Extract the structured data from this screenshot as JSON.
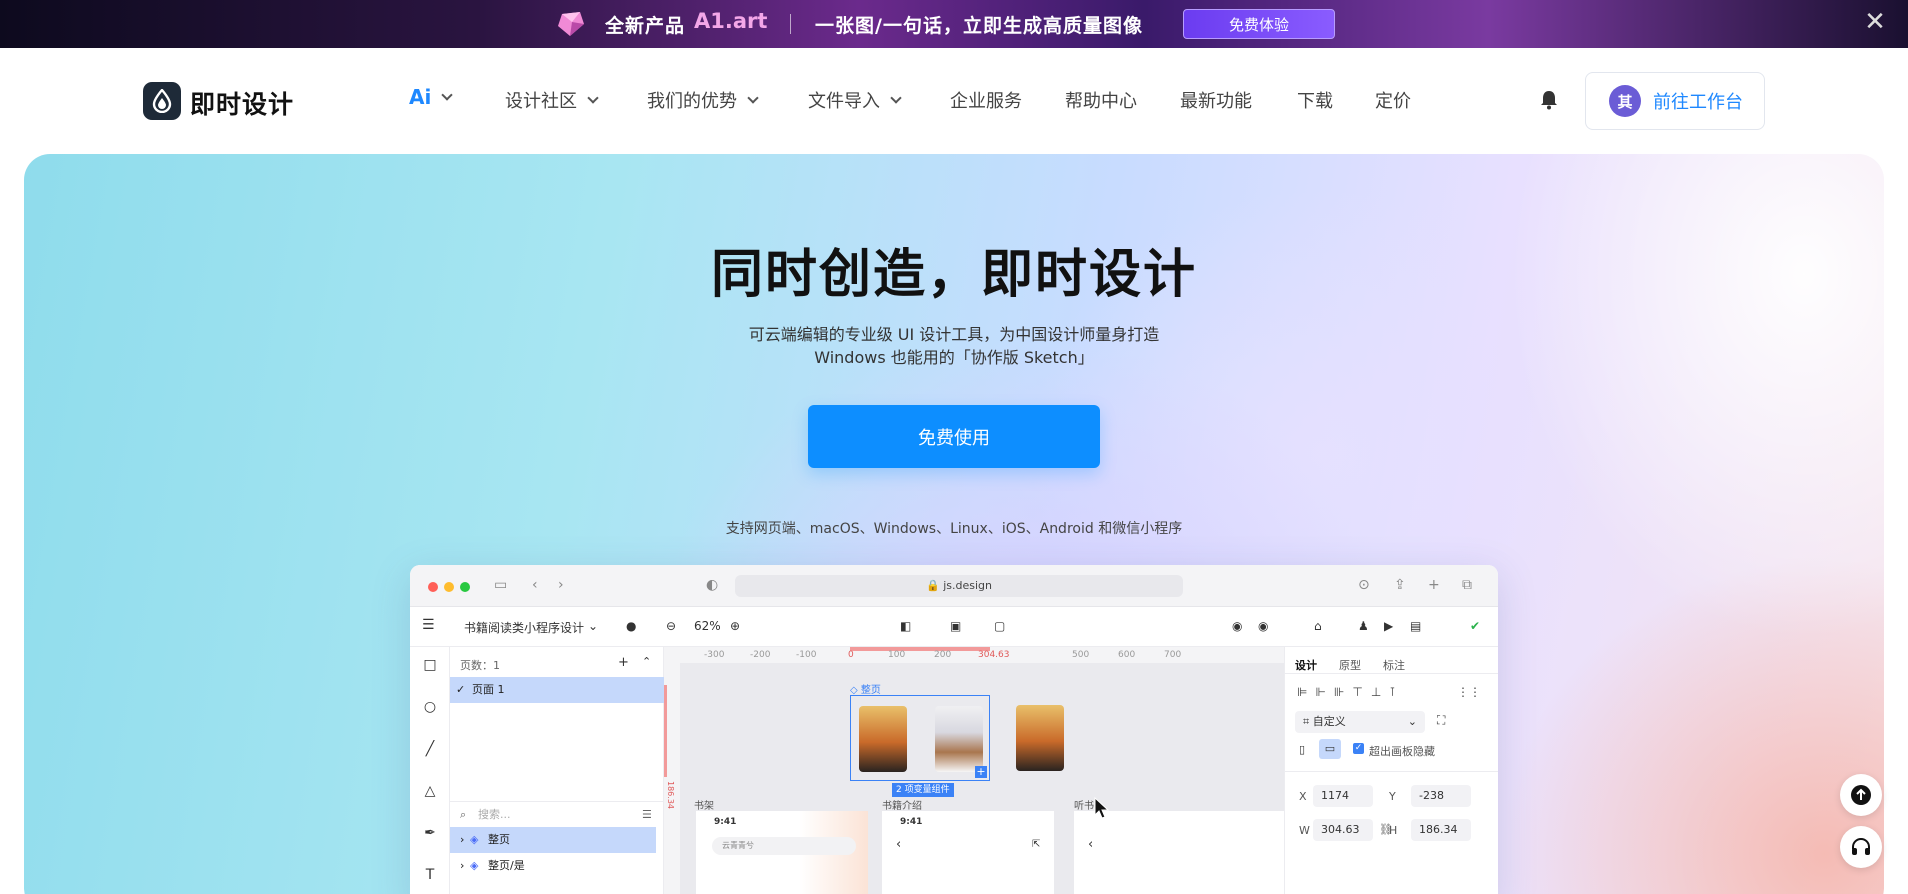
{
  "promo": {
    "product_label": "全新产品",
    "product_name": "A1.art",
    "tagline": "一张图/一句话，立即生成高质量图像",
    "try_button": "免费体验",
    "close_glyph": "✕"
  },
  "nav": {
    "logo_text": "即时设计",
    "items": [
      {
        "label": "Ai"
      },
      {
        "label": "设计社区"
      },
      {
        "label": "我们的优势"
      },
      {
        "label": "文件导入"
      },
      {
        "label": "企业服务"
      },
      {
        "label": "帮助中心"
      },
      {
        "label": "最新功能"
      },
      {
        "label": "下载"
      },
      {
        "label": "定价"
      }
    ],
    "avatar_text": "其",
    "workspace_button": "前往工作台"
  },
  "hero": {
    "title": "同时创造，即时设计",
    "subtitle_line1": "可云端编辑的专业级 UI 设计工具，为中国设计师量身打造",
    "subtitle_line2": "Windows 也能用的「协作版 Sketch」",
    "cta": "免费使用",
    "platforms": "支持网页端、macOS、Windows、Linux、iOS、Android 和微信小程序"
  },
  "app_preview": {
    "url": "js.design",
    "file_name": "书籍阅读类小程序设计",
    "zoom": "62%",
    "pages_header": "页数：1",
    "page_name": "页面 1",
    "search_placeholder": "搜索...",
    "layers": [
      "整页",
      "整页/是"
    ],
    "ruler_ticks": [
      "-300",
      "-200",
      "-100",
      "0",
      "100",
      "200",
      "304.63",
      "500",
      "600",
      "700"
    ],
    "frame_label": "整页",
    "variant_badge": "2 项变量组件",
    "section_labels": [
      "书架",
      "书籍介绍",
      "听书"
    ],
    "phone_time": "9:41",
    "search_box_text": "云青青兮",
    "prop_tabs": [
      "设计",
      "原型",
      "标注"
    ],
    "frame_preset": "自定义",
    "clip_label": "超出画板隐藏",
    "x_label": "X",
    "x_value": "1174",
    "y_label": "Y",
    "y_value": "-238",
    "w_label": "W",
    "w_value": "304.63",
    "h_label": "H",
    "h_value": "186.34",
    "vertical_ruler_value": "186.34"
  },
  "colors": {
    "accent": "#0d8eff",
    "nav_active": "#1e88ff",
    "selection": "#c5d8fb"
  }
}
